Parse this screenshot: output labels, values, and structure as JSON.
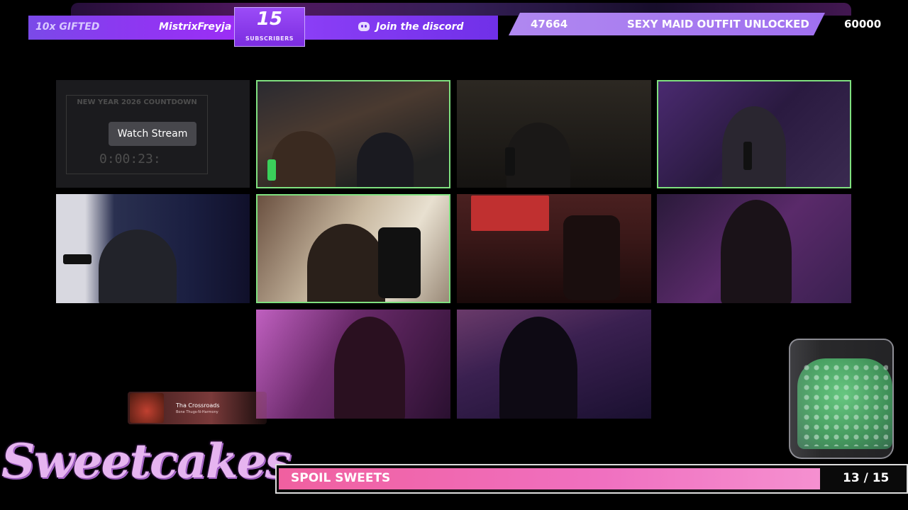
{
  "header": {
    "gift_count": "10x GIFTED",
    "gifter_name": "MistrixFreyja",
    "subscribers_count": "15",
    "subscribers_label": "SUBSCRIBERS",
    "discord_label": "Join the discord"
  },
  "goal": {
    "current": "47664",
    "text": "SEXY MAID OUTFIT UNLOCKED",
    "target": "60000"
  },
  "tiles": {
    "countdown_title": "NEW YEAR 2026 COUNTDOWN",
    "countdown_time": "0:00:23:",
    "watch_stream_label": "Watch Stream"
  },
  "now_playing": {
    "title": "Tha Crossroads",
    "artist": "Bone Thugs-N-Harmony"
  },
  "brand": {
    "logo_text": "Sweetcakes"
  },
  "spoil": {
    "label": "SPOIL SWEETS",
    "count": "13 / 15",
    "progress_fraction": 0.8667
  },
  "colors": {
    "accent_purple": "#8b3ef6",
    "goal_lavender": "#b088f0",
    "active_border": "#7fe07f",
    "spoil_pink": "#f060a0"
  }
}
